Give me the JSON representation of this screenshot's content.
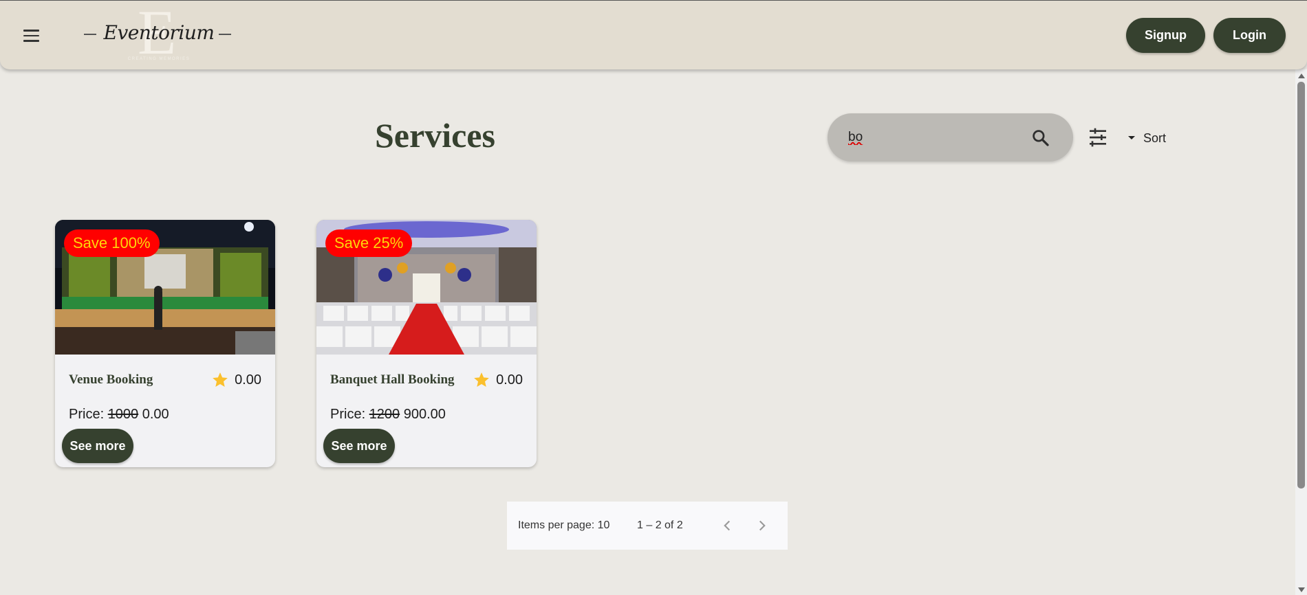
{
  "header": {
    "logo": {
      "letter": "E",
      "name": "Eventorium",
      "tagline": "CREATING MEMORIES"
    },
    "signup_label": "Signup",
    "login_label": "Login"
  },
  "page": {
    "title": "Services",
    "search": {
      "value": "bo"
    },
    "sort_label": "Sort"
  },
  "cards": [
    {
      "badge": "Save 100%",
      "title": "Venue Booking",
      "rating": "0.00",
      "price_label": "Price:",
      "old_price": "1000",
      "new_price": "0.00",
      "button": "See more"
    },
    {
      "badge": "Save 25%",
      "title": "Banquet Hall Booking",
      "rating": "0.00",
      "price_label": "Price:",
      "old_price": "1200",
      "new_price": "900.00",
      "button": "See more"
    }
  ],
  "paginator": {
    "items_per_page_label": "Items per page:",
    "items_per_page": "10",
    "range": "1 – 2 of 2"
  },
  "colors": {
    "primary": "#36412f",
    "header_bg": "#e3ddd1",
    "page_bg": "#ebe9e4",
    "badge_bg": "#ff0000",
    "badge_text": "#ffd60a",
    "star": "#fbc02d"
  },
  "icons": [
    "menu-icon",
    "search-icon",
    "filter-icon",
    "sort-caret-icon",
    "star-icon",
    "chevron-left-icon",
    "chevron-right-icon"
  ]
}
